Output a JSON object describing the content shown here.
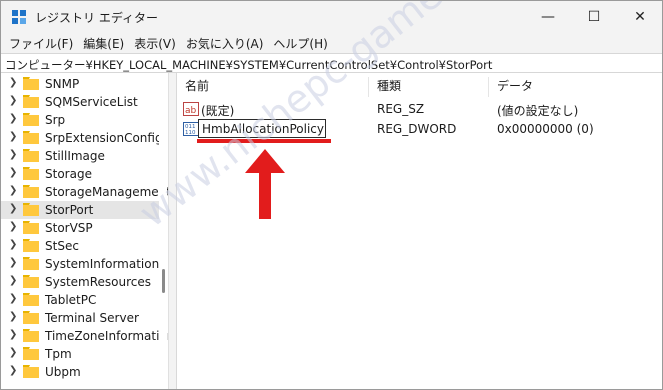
{
  "window": {
    "title": "レジストリ エディター",
    "min_glyph": "—",
    "max_glyph": "☐",
    "close_glyph": "✕"
  },
  "menu": [
    "ファイル(F)",
    "編集(E)",
    "表示(V)",
    "お気に入り(A)",
    "ヘルプ(H)"
  ],
  "address": "コンピューター¥HKEY_LOCAL_MACHINE¥SYSTEM¥CurrentControlSet¥Control¥StorPort",
  "tree": {
    "items": [
      {
        "label": "SNMP",
        "selected": false
      },
      {
        "label": "SQMServiceList",
        "selected": false
      },
      {
        "label": "Srp",
        "selected": false
      },
      {
        "label": "SrpExtensionConfig",
        "selected": false
      },
      {
        "label": "StillImage",
        "selected": false
      },
      {
        "label": "Storage",
        "selected": false
      },
      {
        "label": "StorageManagement",
        "selected": false
      },
      {
        "label": "StorPort",
        "selected": true
      },
      {
        "label": "StorVSP",
        "selected": false
      },
      {
        "label": "StSec",
        "selected": false
      },
      {
        "label": "SystemInformation",
        "selected": false
      },
      {
        "label": "SystemResources",
        "selected": false
      },
      {
        "label": "TabletPC",
        "selected": false
      },
      {
        "label": "Terminal Server",
        "selected": false
      },
      {
        "label": "TimeZoneInformation",
        "selected": false
      },
      {
        "label": "Tpm",
        "selected": false
      },
      {
        "label": "Ubpm",
        "selected": false
      }
    ]
  },
  "list": {
    "headers": {
      "name": "名前",
      "type": "種類",
      "data": "データ"
    },
    "rows": [
      {
        "icon": "string-value-icon",
        "name": "(既定)",
        "type": "REG_SZ",
        "data": "(値の設定なし)"
      },
      {
        "icon": "dword-value-icon",
        "name": "HmbAllocationPolicy",
        "type": "REG_DWORD",
        "data": "0x00000000 (0)",
        "editing": true
      }
    ]
  },
  "annotation": {
    "color": "#e21c1c"
  },
  "watermark": "www.nichepc-gamer.com"
}
